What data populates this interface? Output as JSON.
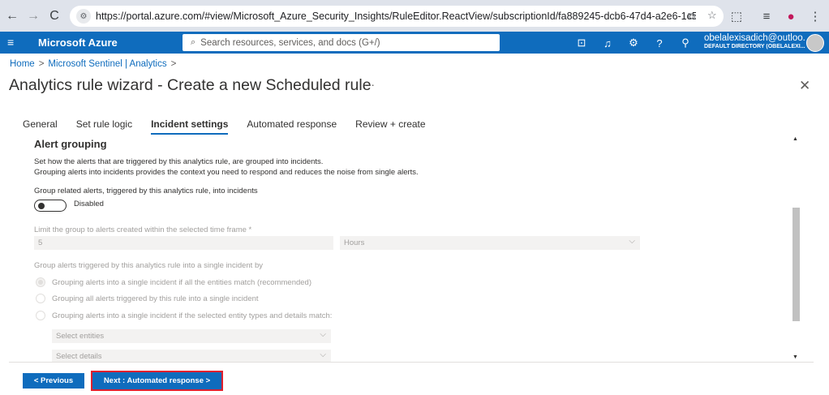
{
  "browser": {
    "url": "https://portal.azure.com/#view/Microsoft_Azure_Security_Insights/RuleEditor.ReactView/subscriptionId/fa889245-dcb6-47d4-a2e6-1c5bf7bd925f/resource...",
    "back_icon": "arrow-left",
    "forward_icon": "arrow-right",
    "reload_icon": "reload"
  },
  "header": {
    "brand": "Microsoft Azure",
    "search_placeholder": "Search resources, services, and docs (G+/)",
    "account_name": "obelalexisadich@outloo...",
    "account_directory": "DEFAULT DIRECTORY (OBELALEXI..."
  },
  "breadcrumb": {
    "home": "Home",
    "sentinel": "Microsoft Sentinel | Analytics"
  },
  "page": {
    "title": "Analytics rule wizard - Create a new Scheduled rule",
    "more": "···"
  },
  "tabs": [
    {
      "label": "General"
    },
    {
      "label": "Set rule logic"
    },
    {
      "label": "Incident settings"
    },
    {
      "label": "Automated response"
    },
    {
      "label": "Review + create"
    }
  ],
  "alert_grouping": {
    "title": "Alert grouping",
    "desc1": "Set how the alerts that are triggered by this analytics rule, are grouped into incidents.",
    "desc2": "Grouping alerts into incidents provides the context you need to respond and reduces the noise from single alerts.",
    "toggle_label": "Group related alerts, triggered by this analytics rule, into incidents",
    "toggle_state": "Disabled",
    "timeframe_label": "Limit the group to alerts created within the selected time frame *",
    "timeframe_value": "5",
    "timeframe_unit": "Hours",
    "group_by_label": "Group alerts triggered by this analytics rule into a single incident by",
    "options": [
      "Grouping alerts into a single incident if all the entities match (recommended)",
      "Grouping all alerts triggered by this rule into a single incident",
      "Grouping alerts into a single incident if the selected entity types and details match:"
    ],
    "select_entities": "Select entities",
    "select_details": "Select details"
  },
  "footer": {
    "prev_label": "< Previous",
    "next_label": "Next : Automated response >"
  }
}
